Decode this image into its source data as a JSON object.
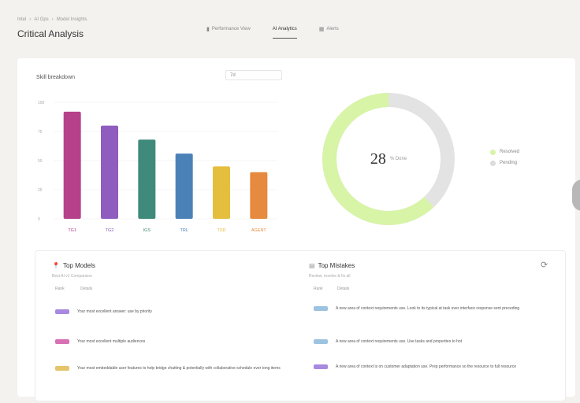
{
  "header": {
    "breadcrumb": [
      "Intel",
      "AI Ops",
      "Model Insights"
    ],
    "title": "Critical Analysis",
    "tabs": [
      {
        "label": "Performance View",
        "icon": "chart-icon",
        "active": false
      },
      {
        "label": "AI Analytics",
        "icon": "",
        "active": true
      },
      {
        "label": "Alerts",
        "icon": "grid-icon",
        "active": false
      }
    ]
  },
  "left_chart": {
    "title": "Skill breakdown",
    "range": "7d",
    "colors": [
      "#b5418a",
      "#8f5cc0",
      "#3f8a7a",
      "#4a82b8",
      "#e5be3e",
      "#e58a3e"
    ]
  },
  "donut": {
    "value": "28",
    "unit": "% Done",
    "colors": {
      "done": "#d7f4a7",
      "rest": "#e3e3e3"
    },
    "legend": [
      {
        "label": "Resolved",
        "color": "#d7f4a7"
      },
      {
        "label": "Pending",
        "color": "#dcdcdc"
      }
    ]
  },
  "chart_data": {
    "type": "bar",
    "categories": [
      "TG1",
      "TG2",
      "IGS",
      "TRL",
      "TSD",
      "AGENT"
    ],
    "values": [
      92,
      80,
      68,
      56,
      45,
      40
    ],
    "ylim": [
      0,
      100
    ],
    "ytick_labels": [
      "0",
      "25",
      "50",
      "75",
      "100"
    ]
  },
  "panel": {
    "models": {
      "title": "Top Models",
      "subtitle": "Best AI v1 Comparison",
      "col1": "Rank",
      "col2": "Details",
      "rows": [
        {
          "text": "Your most excellent answer: use by priority",
          "color": "#a889e0"
        },
        {
          "text": "Your most excellent multiple audiences",
          "color": "#d870b5"
        },
        {
          "text": "Your most embeddable user features to help bridge chatting & potentially with collaborative schedule over tong items",
          "color": "#e5c56b"
        }
      ]
    },
    "mistakes": {
      "title": "Top Mistakes",
      "subtitle": "Review, resolve & fix all",
      "col1": "Rank",
      "col2": "Details",
      "rows": [
        {
          "text": "A new area of context requirements use. Look to its typical at task ever interface response sent preceding",
          "color": "#9cc3e0"
        },
        {
          "text": "A new area of context requirements use. Use tasks and properties to hot",
          "color": "#9cc3e0"
        },
        {
          "text": "A new area of context is on customer adaptation use. Prep performance so the resource to full resource",
          "color": "#a889e0"
        }
      ]
    }
  }
}
